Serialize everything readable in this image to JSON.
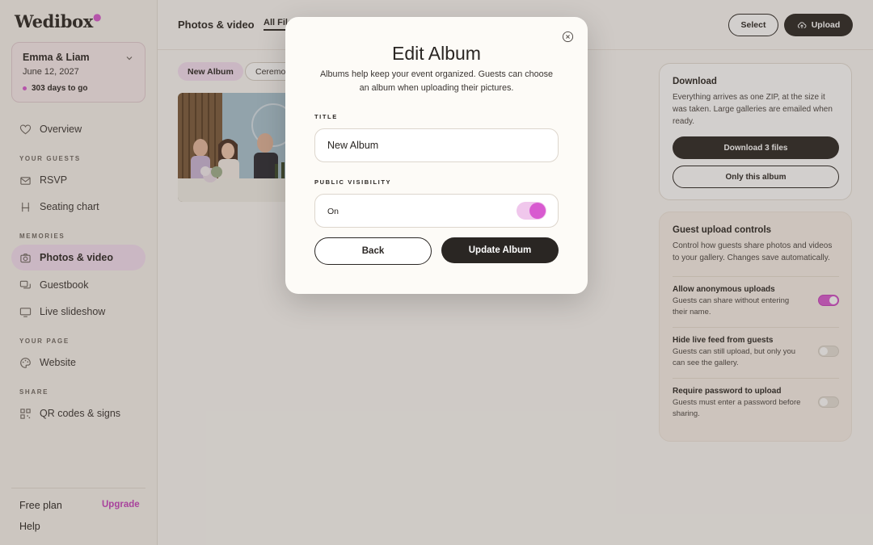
{
  "brand": {
    "logo_text": "Wedibox",
    "accent_color": "#d85ad0"
  },
  "event": {
    "name": "Emma & Liam",
    "date": "June 12, 2027",
    "countdown": "303 days to go"
  },
  "sidebar": {
    "items": [
      {
        "label": "Overview",
        "icon": "heart-icon"
      },
      {
        "label": "RSVP",
        "icon": "envelope-icon"
      },
      {
        "label": "Seating chart",
        "icon": "chair-icon"
      },
      {
        "label": "Photos & video",
        "icon": "camera-icon",
        "active": true
      },
      {
        "label": "Guestbook",
        "icon": "chat-icon"
      },
      {
        "label": "Live slideshow",
        "icon": "monitor-icon"
      },
      {
        "label": "Website",
        "icon": "palette-icon"
      },
      {
        "label": "QR codes & signs",
        "icon": "qr-icon"
      }
    ],
    "sections": {
      "guests": "YOUR GUESTS",
      "memories": "MEMORIES",
      "page": "YOUR PAGE",
      "share": "SHARE"
    },
    "footer": {
      "plan": "Free plan",
      "upgrade": "Upgrade",
      "help": "Help"
    }
  },
  "header": {
    "title": "Photos & video",
    "tab_all": "All Files",
    "select": "Select",
    "upload": "Upload"
  },
  "albums": {
    "new": "New Album",
    "ceremony": "Ceremony"
  },
  "download_panel": {
    "title": "Download",
    "desc": "Everything arrives as one ZIP, at the size it was taken. Large galleries are emailed when ready.",
    "download_btn": "Download 3 files",
    "album_btn": "Only this album"
  },
  "guest_panel": {
    "title": "Guest upload controls",
    "desc": "Control how guests share photos and videos to your gallery. Changes save automatically.",
    "controls": [
      {
        "title": "Allow anonymous uploads",
        "desc": "Guests can share without entering their name.",
        "on": true
      },
      {
        "title": "Hide live feed from guests",
        "desc": "Guests can still upload, but only you can see the gallery.",
        "on": false
      },
      {
        "title": "Require password to upload",
        "desc": "Guests must enter a password before sharing.",
        "on": false
      }
    ]
  },
  "modal": {
    "title": "Edit Album",
    "desc": "Albums help keep your event organized. Guests can choose an album when uploading their pictures.",
    "title_label": "TITLE",
    "title_value": "New Album",
    "visibility_label": "PUBLIC VISIBILITY",
    "visibility_value": "On",
    "visibility_on": true,
    "back": "Back",
    "update": "Update Album"
  }
}
